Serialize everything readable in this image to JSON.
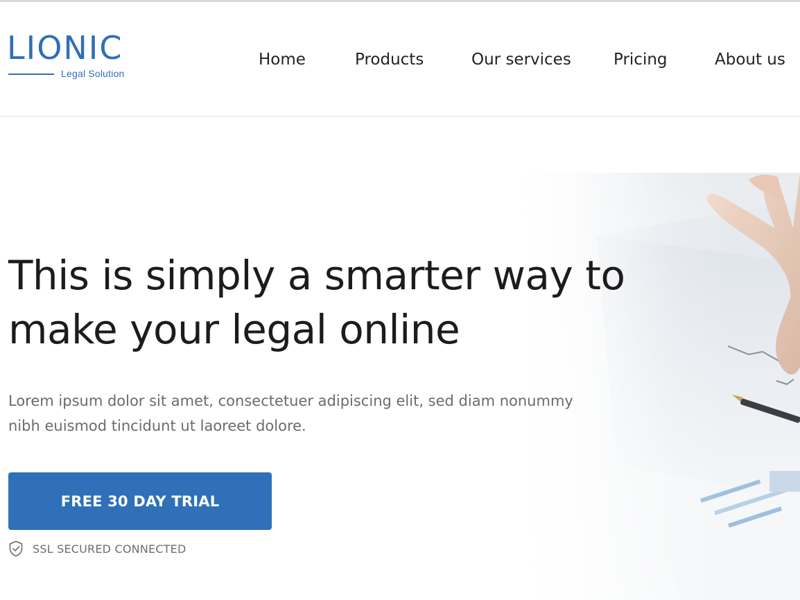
{
  "brand": {
    "name": "LIONIC",
    "tagline": "Legal Solution",
    "color": "#2f6fb7"
  },
  "nav": {
    "items": [
      {
        "label": "Home"
      },
      {
        "label": "Products"
      },
      {
        "label": "Our services"
      },
      {
        "label": "Pricing"
      },
      {
        "label": "About us"
      }
    ]
  },
  "hero": {
    "headline_line1": "This is simply a smarter way to",
    "headline_line2": "make your legal online",
    "subtext_line1": "Lorem ipsum dolor sit amet, consectetuer adipiscing elit, sed diam nonummy",
    "subtext_line2": "nibh euismod tincidunt ut laoreet dolore.",
    "cta_label": "FREE 30 DAY TRIAL",
    "cta_color": "#2f70b8",
    "security_icon": "shield-check-icon",
    "security_label": "SSL SECURED CONNECTED"
  }
}
